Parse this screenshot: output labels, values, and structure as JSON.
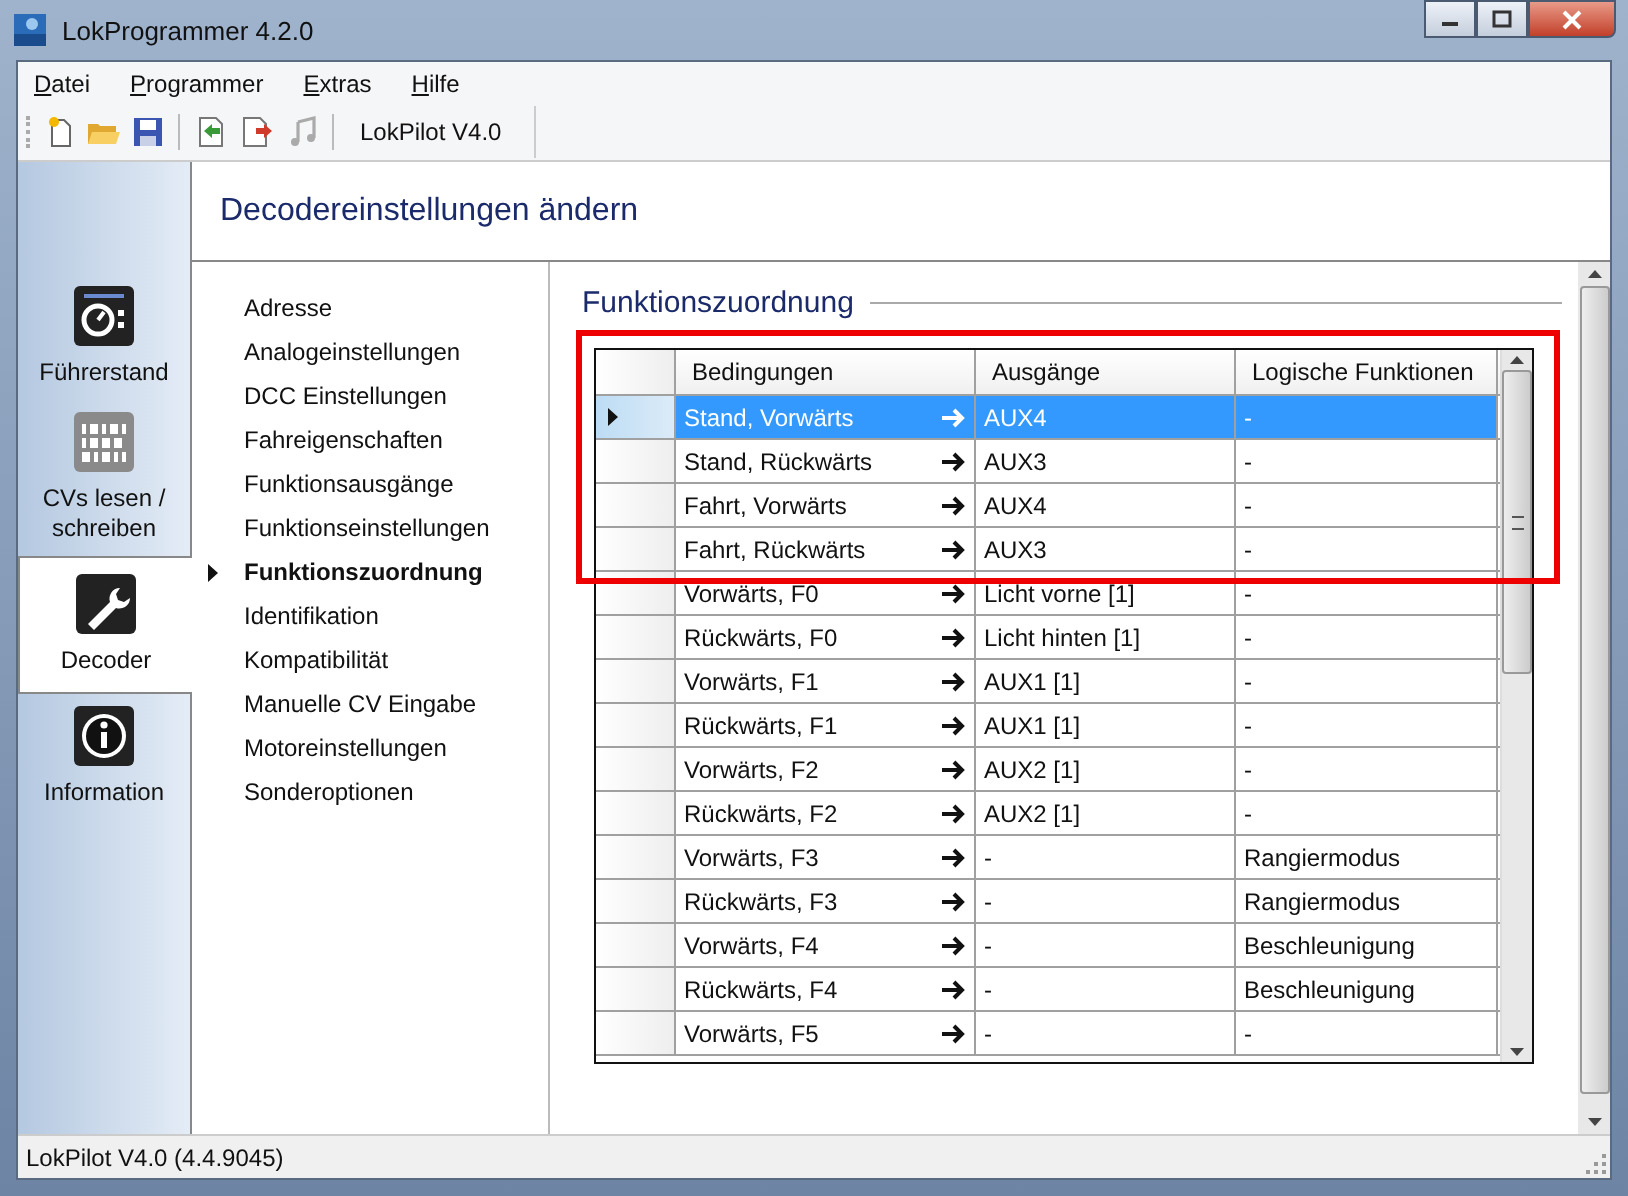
{
  "window": {
    "title": "LokProgrammer 4.2.0"
  },
  "menu": [
    {
      "label": "Datei"
    },
    {
      "label": "Programmer"
    },
    {
      "label": "Extras"
    },
    {
      "label": "Hilfe"
    }
  ],
  "toolbar": {
    "device": "LokPilot V4.0"
  },
  "nav": [
    {
      "label": "Führerstand",
      "kind": "cab",
      "selected": false
    },
    {
      "label": "CVs lesen / schreiben",
      "kind": "binary",
      "selected": false
    },
    {
      "label": "Decoder",
      "kind": "wrench",
      "selected": true
    },
    {
      "label": "Information",
      "kind": "info",
      "selected": false
    }
  ],
  "header": "Decodereinstellungen ändern",
  "settings": [
    {
      "label": "Adresse",
      "selected": false
    },
    {
      "label": "Analogeinstellungen",
      "selected": false
    },
    {
      "label": "DCC Einstellungen",
      "selected": false
    },
    {
      "label": "Fahreigenschaften",
      "selected": false
    },
    {
      "label": "Funktionsausgänge",
      "selected": false
    },
    {
      "label": "Funktionseinstellungen",
      "selected": false
    },
    {
      "label": "Funktionszuordnung",
      "selected": true
    },
    {
      "label": "Identifikation",
      "selected": false
    },
    {
      "label": "Kompatibilität",
      "selected": false
    },
    {
      "label": "Manuelle CV Eingabe",
      "selected": false
    },
    {
      "label": "Motoreinstellungen",
      "selected": false
    },
    {
      "label": "Sonderoptionen",
      "selected": false
    }
  ],
  "section_title": "Funktionszuordnung",
  "table": {
    "columns": [
      "Bedingungen",
      "Ausgänge",
      "Logische Funktionen"
    ],
    "rows": [
      {
        "condition": "Stand, Vorwärts",
        "output": "AUX4",
        "logic": "-",
        "selected": true
      },
      {
        "condition": "Stand, Rückwärts",
        "output": "AUX3",
        "logic": "-",
        "selected": false
      },
      {
        "condition": "Fahrt, Vorwärts",
        "output": "AUX4",
        "logic": "-",
        "selected": false
      },
      {
        "condition": "Fahrt, Rückwärts",
        "output": "AUX3",
        "logic": "-",
        "selected": false
      },
      {
        "condition": "Vorwärts, F0",
        "output": "Licht vorne [1]",
        "logic": "-",
        "selected": false
      },
      {
        "condition": "Rückwärts, F0",
        "output": "Licht hinten [1]",
        "logic": "-",
        "selected": false
      },
      {
        "condition": "Vorwärts, F1",
        "output": "AUX1 [1]",
        "logic": "-",
        "selected": false
      },
      {
        "condition": "Rückwärts, F1",
        "output": "AUX1 [1]",
        "logic": "-",
        "selected": false
      },
      {
        "condition": "Vorwärts, F2",
        "output": "AUX2 [1]",
        "logic": "-",
        "selected": false
      },
      {
        "condition": "Rückwärts, F2",
        "output": "AUX2 [1]",
        "logic": "-",
        "selected": false
      },
      {
        "condition": "Vorwärts, F3",
        "output": "-",
        "logic": "Rangiermodus",
        "selected": false
      },
      {
        "condition": "Rückwärts, F3",
        "output": "-",
        "logic": "Rangiermodus",
        "selected": false
      },
      {
        "condition": "Vorwärts, F4",
        "output": "-",
        "logic": "Beschleunigung",
        "selected": false
      },
      {
        "condition": "Rückwärts, F4",
        "output": "-",
        "logic": "Beschleunigung",
        "selected": false
      },
      {
        "condition": "Vorwärts, F5",
        "output": "-",
        "logic": "-",
        "selected": false
      }
    ]
  },
  "status_bar": "LokPilot V4.0 (4.4.9045)"
}
